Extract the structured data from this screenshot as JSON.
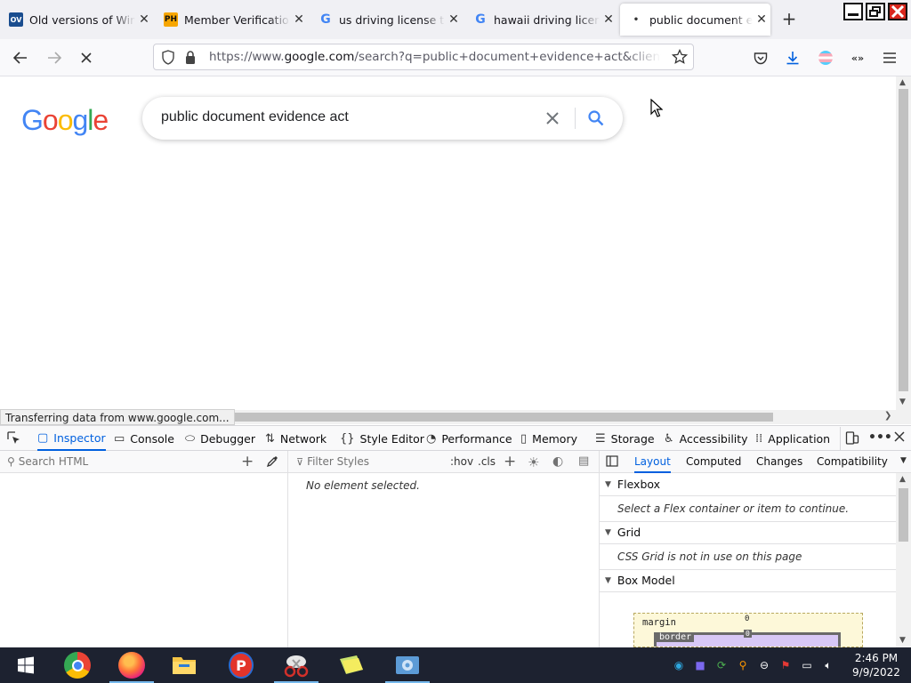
{
  "tabs": [
    {
      "title": "Old versions of Windo",
      "favicon": "OV",
      "icon": "oldversion-favicon"
    },
    {
      "title": "Member Verification -",
      "favicon": "PH",
      "icon": "ph-favicon"
    },
    {
      "title": "us driving license the",
      "favicon": "G",
      "icon": "google-favicon"
    },
    {
      "title": "hawaii driving license",
      "favicon": "G",
      "icon": "google-favicon"
    },
    {
      "title": "public document evid",
      "favicon": "•",
      "icon": "loading-dot"
    }
  ],
  "urlbar": {
    "url_prefix": "https://www.",
    "url_domain": "google.com",
    "url_rest": "/search?q=public+document+evidence+act&client=firefox-b-d"
  },
  "search": {
    "query": "public document evidence act",
    "logo": "Google"
  },
  "status_text": "Transferring data from www.google.com...",
  "devtools": {
    "tabs": [
      {
        "label": "Inspector",
        "icon": "inspector-icon"
      },
      {
        "label": "Console",
        "icon": "console-icon"
      },
      {
        "label": "Debugger",
        "icon": "debugger-icon"
      },
      {
        "label": "Network",
        "icon": "network-icon"
      },
      {
        "label": "Style Editor",
        "icon": "style-editor-icon"
      },
      {
        "label": "Performance",
        "icon": "performance-icon"
      },
      {
        "label": "Memory",
        "icon": "memory-icon"
      },
      {
        "label": "Storage",
        "icon": "storage-icon"
      },
      {
        "label": "Accessibility",
        "icon": "accessibility-icon"
      },
      {
        "label": "Application",
        "icon": "application-icon"
      }
    ],
    "search_html_placeholder": "Search HTML",
    "filter_styles_placeholder": "Filter Styles",
    "hov": ":hov",
    "cls": ".cls",
    "no_element": "No element selected.",
    "layout_tabs": [
      "Layout",
      "Computed",
      "Changes",
      "Compatibility"
    ],
    "sections": [
      {
        "title": "Flexbox",
        "note": "Select a Flex container or item to continue."
      },
      {
        "title": "Grid",
        "note": "CSS Grid is not in use on this page"
      },
      {
        "title": "Box Model",
        "note": ""
      }
    ],
    "box_model": {
      "margin_label": "margin",
      "border_label": "border",
      "margin_value": "0",
      "border_value": "0"
    }
  },
  "taskbar": {
    "time": "2:46 PM",
    "date": "9/9/2022"
  },
  "colors": {
    "accent": "#0060df",
    "google_blue": "#4285f4",
    "google_red": "#ea4335",
    "google_yellow": "#fbbc05",
    "google_green": "#34a853",
    "taskbar": "#1d2230"
  }
}
